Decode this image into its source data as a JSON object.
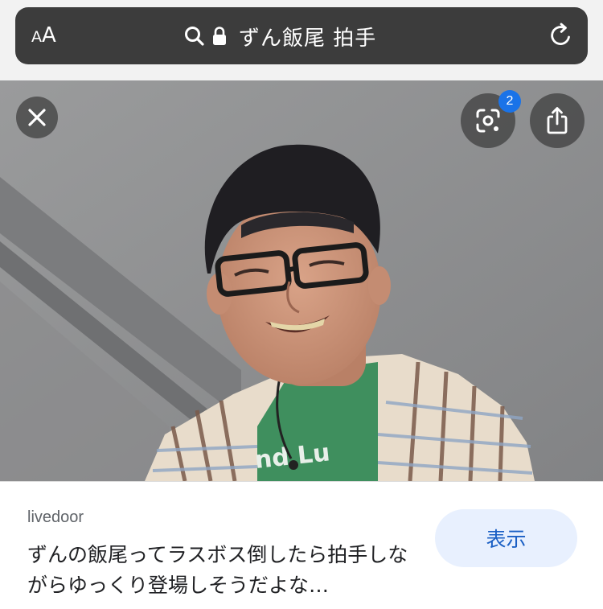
{
  "browser": {
    "aa_small": "A",
    "aa_big": "A",
    "url_text": "ずん飯尾 拍手",
    "icons": [
      "search-icon",
      "lock-icon",
      "reload-icon"
    ]
  },
  "viewer": {
    "icons": [
      "close-icon",
      "lens-icon",
      "share-icon"
    ],
    "lens_badge": "2",
    "accent_color": "#1a73e8"
  },
  "result": {
    "source": "livedoor",
    "caption": "ずんの飯尾ってラスボス倒したら拍手しながらゆっくり登場しそうだよな…",
    "show_button": "表示"
  }
}
